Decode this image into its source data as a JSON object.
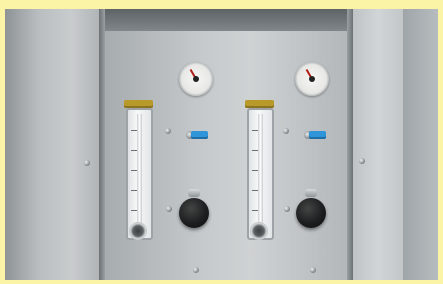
{
  "scene": {
    "background_color": "#fbf3a6",
    "panel_color": "#c5c9cb",
    "flowmeter_head_color": "#b89a2b",
    "valve_handle_color": "#2f95d8",
    "knob_color": "#1d1f20"
  },
  "units": [
    {
      "name": "left",
      "gauge": {
        "icon": "pressure-gauge-icon"
      },
      "flowmeter": {
        "icon": "flowmeter-icon"
      },
      "valve": {
        "icon": "blue-lever-valve-icon"
      },
      "knob": {
        "icon": "regulator-knob-icon"
      }
    },
    {
      "name": "right",
      "gauge": {
        "icon": "pressure-gauge-icon"
      },
      "flowmeter": {
        "icon": "flowmeter-icon"
      },
      "valve": {
        "icon": "blue-lever-valve-icon"
      },
      "knob": {
        "icon": "regulator-knob-icon"
      }
    }
  ]
}
